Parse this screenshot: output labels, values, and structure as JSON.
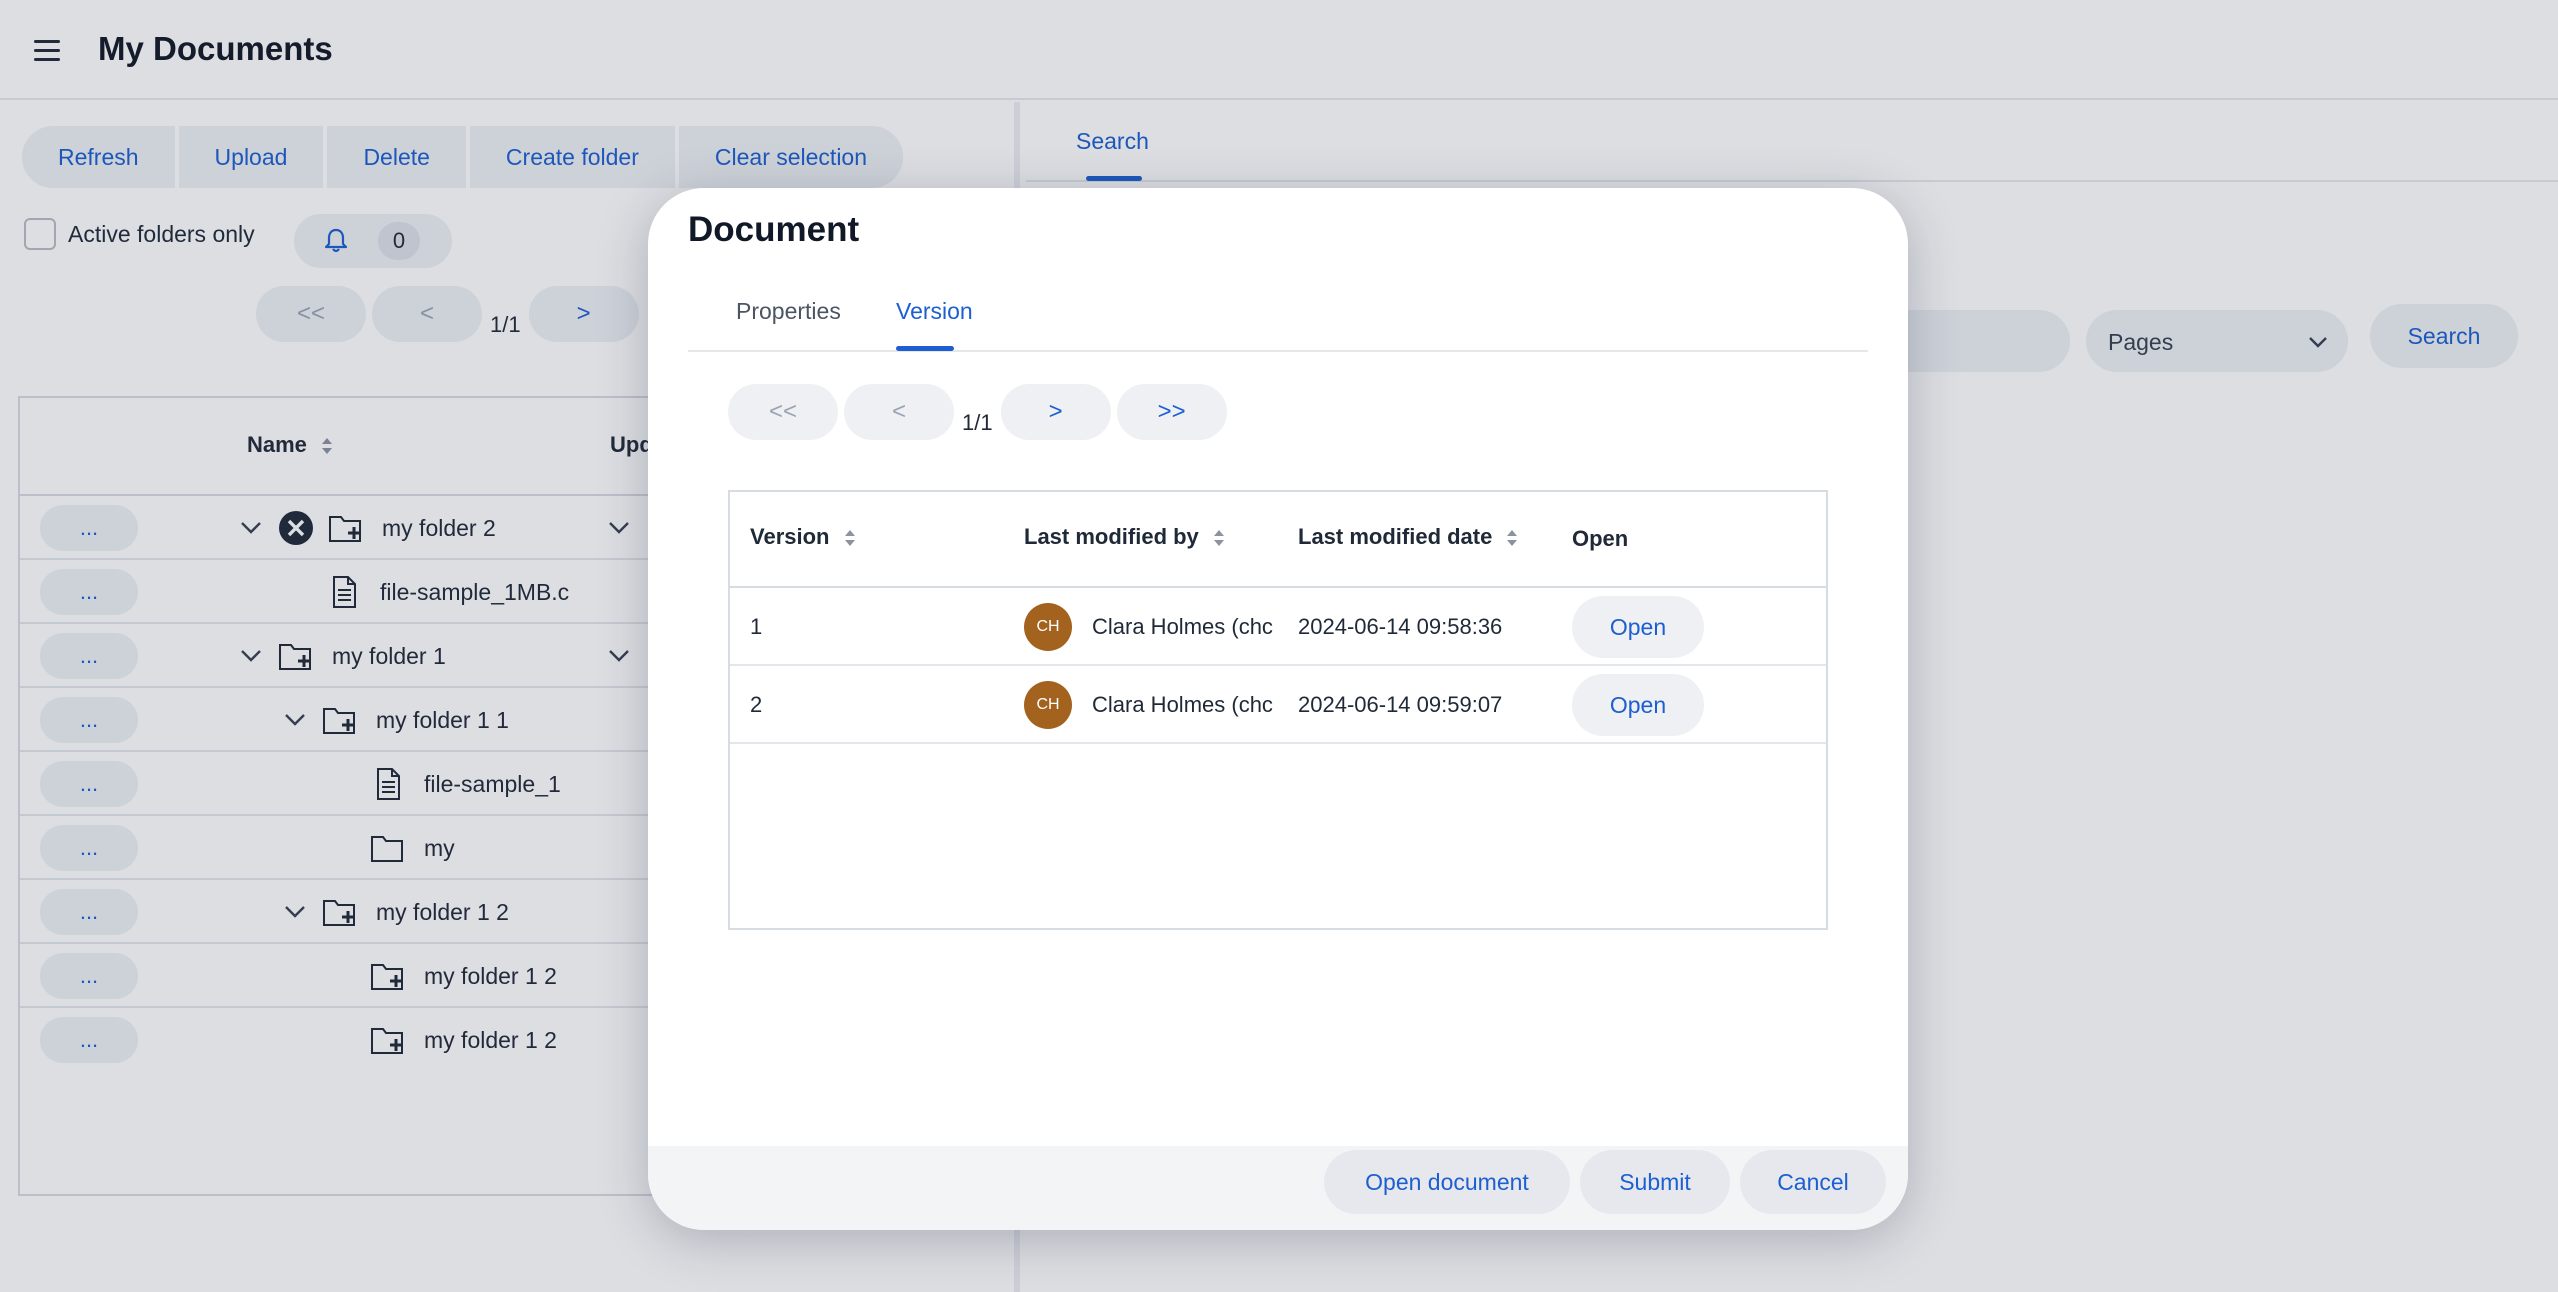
{
  "header": {
    "title": "My Documents",
    "menu_icon": "hamburger-icon"
  },
  "toolbar": {
    "refresh": "Refresh",
    "upload": "Upload",
    "delete": "Delete",
    "create_folder": "Create folder",
    "clear_selection": "Clear selection"
  },
  "filters": {
    "active_folders_label": "Active folders only",
    "notification_count": "0"
  },
  "left_pager": {
    "first": "<<",
    "prev": "<",
    "page": "1/1",
    "next": ">"
  },
  "tree": {
    "columns": {
      "name": "Name",
      "updated": "Upd"
    },
    "more_label": "...",
    "rows": [
      {
        "label": "my folder 2"
      },
      {
        "label": "file-sample_1MB.c"
      },
      {
        "label": "my folder 1"
      },
      {
        "label": "my folder 1 1"
      },
      {
        "label": "file-sample_1"
      },
      {
        "label": "my"
      },
      {
        "label": "my folder 1 2"
      },
      {
        "label": "my folder 1 2"
      },
      {
        "label": "my folder 1 2"
      }
    ]
  },
  "right": {
    "tab": "Search",
    "pages_select": "Pages",
    "search_button": "Search"
  },
  "dialog": {
    "title": "Document",
    "tabs": {
      "properties": "Properties",
      "version": "Version"
    },
    "pager": {
      "first": "<<",
      "prev": "<",
      "page": "1/1",
      "next": ">",
      "last": ">>"
    },
    "table": {
      "headers": {
        "version": "Version",
        "modified_by": "Last modified by",
        "modified_date": "Last modified date",
        "open": "Open"
      },
      "rows": [
        {
          "version": "1",
          "initials": "CH",
          "user": "Clara Holmes (chc",
          "date": "2024-06-14 09:58:36",
          "open": "Open"
        },
        {
          "version": "2",
          "initials": "CH",
          "user": "Clara Holmes (chc",
          "date": "2024-06-14 09:59:07",
          "open": "Open"
        }
      ]
    },
    "footer": {
      "open_document": "Open document",
      "submit": "Submit",
      "cancel": "Cancel"
    }
  },
  "colors": {
    "accent": "#1d5fd1",
    "avatar": "#a4621f"
  }
}
